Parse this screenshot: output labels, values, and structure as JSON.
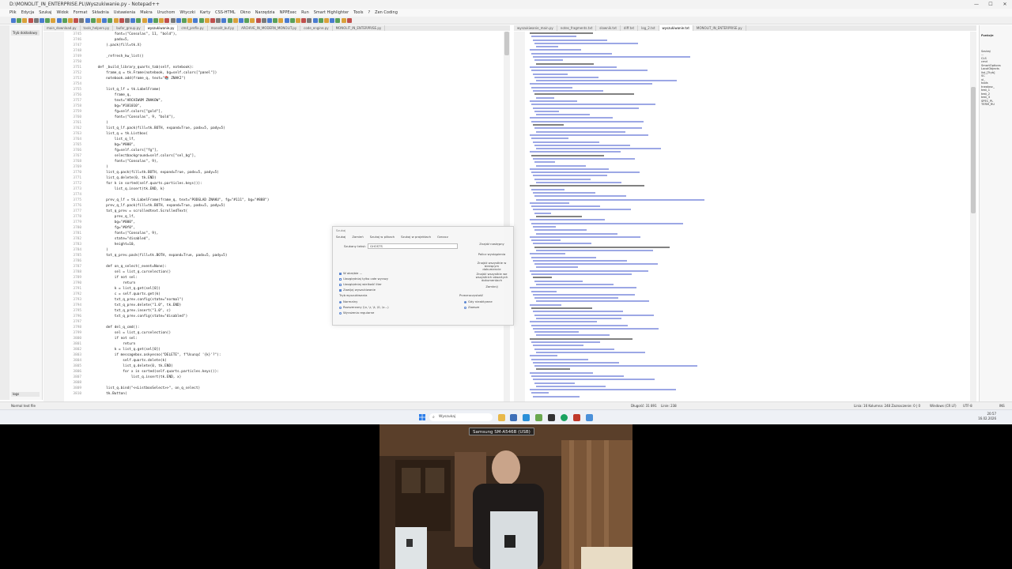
{
  "window": {
    "title": "D:\\MONOLIT_IN_ENTERPRISE.PL\\Wyszukiwanie.py - Notepad++",
    "min_label": "—",
    "max_label": "☐",
    "close_label": "✕"
  },
  "menu": {
    "items": [
      "Plik",
      "Edycja",
      "Szukaj",
      "Widok",
      "Format",
      "Składnia",
      "Ustawienia",
      "Makra",
      "Uruchom",
      "Wtyczki",
      "Karty",
      "CSS-HTML",
      "Okno",
      "Narzędzia",
      "NPPExec",
      "Run",
      "Smart Highlighter",
      "Tools",
      "?",
      "Zen Coding"
    ]
  },
  "left_panel": {
    "tab_label": "Tryb dokładowy",
    "bottom_label": "logs"
  },
  "editor_left": {
    "tabs": [
      "main_download.py",
      "tools_helpers.py",
      "bufor_group.py",
      "wyszukiwanie.py",
      "cmd_prefix.py",
      "monolit_buf.py",
      "ARCHIVE_IN_MODERN_MONOLIT.py",
      "code_engine.py",
      "MONOLIT_IN_ENTERPRISE.py"
    ],
    "active_tab": 3,
    "lines": [
      {
        "n": "3745",
        "t": "            font=(\"Consolas\", 11, \"bold\"),"
      },
      {
        "n": "3746",
        "t": "            padx=5,"
      },
      {
        "n": "3747",
        "t": "        ).pack(fill=tk.X)"
      },
      {
        "n": "3748",
        "t": ""
      },
      {
        "n": "3749",
        "t": "        _refresh_kw_list()"
      },
      {
        "n": "3750",
        "t": ""
      },
      {
        "n": "3751",
        "t": "    def _build_library_quarts_tab(self, notebook):"
      },
      {
        "n": "3752",
        "t": "        frame_q = tk.Frame(notebook, bg=self.colors[\"panel\"])"
      },
      {
        "n": "3753",
        "t": "        notebook.add(frame_q, text=\"📚 ZNAKI\")"
      },
      {
        "n": "3754",
        "t": ""
      },
      {
        "n": "3755",
        "t": "        list_q_lf = tk.LabelFrame("
      },
      {
        "n": "3756",
        "t": "            frame_q,"
      },
      {
        "n": "3757",
        "t": "            text=\"ARCHIWUM ZNAKOW\","
      },
      {
        "n": "3758",
        "t": "            bg=\"#101010\","
      },
      {
        "n": "3759",
        "t": "            fg=self.colors[\"gold\"],"
      },
      {
        "n": "3760",
        "t": "            font=(\"Consolas\", 9, \"bold\"),"
      },
      {
        "n": "3761",
        "t": "        )"
      },
      {
        "n": "3762",
        "t": "        list_q_lf.pack(fill=tk.BOTH, expand=True, padx=5, pady=5)"
      },
      {
        "n": "3763",
        "t": "        list_q = tk.Listbox("
      },
      {
        "n": "3764",
        "t": "            list_q_lf,"
      },
      {
        "n": "3765",
        "t": "            bg=\"#000\","
      },
      {
        "n": "3766",
        "t": "            fg=self.colors[\"fg\"],"
      },
      {
        "n": "3767",
        "t": "            selectbackground=self.colors[\"sel_bg\"],"
      },
      {
        "n": "3768",
        "t": "            font=(\"Consolas\", 9),"
      },
      {
        "n": "3769",
        "t": "        )"
      },
      {
        "n": "3770",
        "t": "        list_q.pack(fill=tk.BOTH, expand=True, padx=5, pady=5)"
      },
      {
        "n": "3771",
        "t": "        list_q.delete(0, tk.END)"
      },
      {
        "n": "3772",
        "t": "        for k in sorted(self.quarts.particles.keys()):"
      },
      {
        "n": "3773",
        "t": "            list_q.insert(tk.END, k)"
      },
      {
        "n": "3774",
        "t": ""
      },
      {
        "n": "3775",
        "t": "        prev_q_lf = tk.LabelFrame(frame_q, text=\"PODGLAD ZNAKU\", fg=\"#111\", bg=\"#888\")"
      },
      {
        "n": "3776",
        "t": "        prev_q_lf.pack(fill=tk.BOTH, expand=True, padx=5, pady=5)"
      },
      {
        "n": "3777",
        "t": "        txt_q_prev = scrolledtext.ScrolledText("
      },
      {
        "n": "3778",
        "t": "            prev_q_lf,"
      },
      {
        "n": "3779",
        "t": "            bg=\"#000\","
      },
      {
        "n": "3780",
        "t": "            fg=\"#0f0\","
      },
      {
        "n": "3781",
        "t": "            font=(\"Consolas\", 9),"
      },
      {
        "n": "3782",
        "t": "            state=\"disabled\","
      },
      {
        "n": "3783",
        "t": "            height=10,"
      },
      {
        "n": "3784",
        "t": "        )"
      },
      {
        "n": "3785",
        "t": "        txt_q_prev.pack(fill=tk.BOTH, expand=True, padx=5, pady=5)"
      },
      {
        "n": "3786",
        "t": ""
      },
      {
        "n": "3787",
        "t": "        def on_q_select(_event=None):"
      },
      {
        "n": "3788",
        "t": "            sel = list_q.curselection()"
      },
      {
        "n": "3789",
        "t": "            if not sel:"
      },
      {
        "n": "3790",
        "t": "                return"
      },
      {
        "n": "3791",
        "t": "            k = list_q.get(sel[0])"
      },
      {
        "n": "3792",
        "t": "            c = self.quarts.get(k)"
      },
      {
        "n": "3793",
        "t": "            txt_q_prev.config(state=\"normal\")"
      },
      {
        "n": "3794",
        "t": "            txt_q_prev.delete(\"1.0\", tk.END)"
      },
      {
        "n": "3795",
        "t": "            txt_q_prev.insert(\"1.0\", c)"
      },
      {
        "n": "3796",
        "t": "            txt_q_prev.config(state=\"disabled\")"
      },
      {
        "n": "3797",
        "t": ""
      },
      {
        "n": "3798",
        "t": "        def del_q_cmd():"
      },
      {
        "n": "3799",
        "t": "            sel = list_q.curselection()"
      },
      {
        "n": "3800",
        "t": "            if not sel:"
      },
      {
        "n": "3801",
        "t": "                return"
      },
      {
        "n": "3802",
        "t": "            k = list_q.get(sel[0])"
      },
      {
        "n": "3803",
        "t": "            if messagebox.askyesno(\"DELETE\", f\"Usunąć '{k}'?\"):"
      },
      {
        "n": "3804",
        "t": "                self.quarts.delete(k)"
      },
      {
        "n": "3805",
        "t": "                list_q.delete(0, tk.END)"
      },
      {
        "n": "3806",
        "t": "                for x in sorted(self.quarts.particles.keys()):"
      },
      {
        "n": "3807",
        "t": "                    list_q.insert(tk.END, x)"
      },
      {
        "n": "3808",
        "t": ""
      },
      {
        "n": "3809",
        "t": "        list_q.bind(\"<<ListboxSelect>>\", on_q_select)"
      },
      {
        "n": "3810",
        "t": "        tk.Button("
      }
    ]
  },
  "editor_right": {
    "tabs": [
      "wyszukiwanie_main.py",
      "notes_fragments.txt",
      "slownik.txt",
      "diff.txt",
      "log_2.txt",
      "wyszukiwanie.txt",
      "MONOLIT_IN_ENTERPRISE.py"
    ],
    "active_tab": 5
  },
  "side_panel": {
    "title": "Funkcje",
    "lines": [
      "Szukaj",
      "...",
      "CLS",
      "cmd",
      "SmartOptions",
      "LocalObjects",
      "list_[Tryb]",
      "SC",
      "ui_",
      "tools",
      "trwalosc_",
      "",
      "test_1",
      "test_2",
      "test_3",
      "SPEC_PL",
      "TERM_RU"
    ]
  },
  "find_dialog": {
    "title": "Szukaj",
    "tabs": [
      "Szukaj",
      "Zamień",
      "Szukaj w plikach",
      "Szukaj w projektach",
      "Oznacz"
    ],
    "find_label": "Szukany tekst:",
    "find_value": "GHOSTS",
    "buttons": [
      "Znajdź następny",
      "Policz wystąpienia",
      "Znajdź wszystkie w bieżącym dokumencie",
      "Znajdź wszystkie we wszystkich otwartych dokumentach",
      "Zamknij"
    ],
    "options": [
      "W obrębie ...",
      "Uwzględniaj tylko całe wyrazy",
      "Uwzględniaj wielkość liter",
      "Zawijaj wyszukiwanie"
    ],
    "mode_title": "Tryb wyszukiwania",
    "modes": [
      "Normalny",
      "Rozszerzony (\\n, \\r, \\t, \\0, \\x...)",
      "Wyrażenia regularne"
    ],
    "transparency_title": "Przezroczystość",
    "transparency_options": [
      "Gdy nieaktywne",
      "Zawsze"
    ]
  },
  "statusbar": {
    "left": "Normal text file",
    "length": "Długość: 31 891",
    "lines": "Linie: 238",
    "cursor": "Linia: 16  Kolumna: 248  Zaznaczenie: 0 | 0",
    "eol": "Windows (CR LF)",
    "encoding": "UTF-8",
    "mode": "INS"
  },
  "taskbar": {
    "search_placeholder": "Wyszukaj",
    "time": "20:57",
    "date": "16.02.2026"
  },
  "webcam": {
    "label": "Samsung SM-A546B (USB)"
  }
}
